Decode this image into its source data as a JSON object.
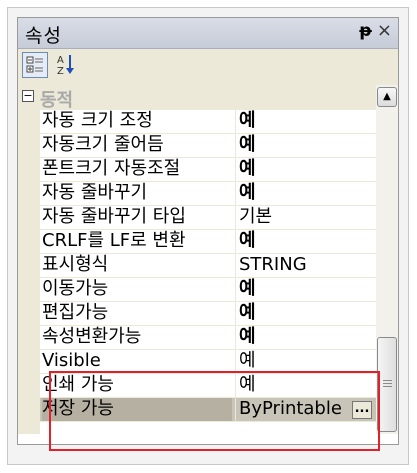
{
  "panel": {
    "title": "속성",
    "pin_glyph": "ᵽ",
    "close_glyph": "×"
  },
  "toolbar": {
    "categorized_icon": "categorized-view-icon",
    "alphabetical_icon": "alphabetical-sort-icon",
    "alphabetical_label": "A↓Z"
  },
  "category": {
    "toggle": "−",
    "label": "동적"
  },
  "properties": [
    {
      "name": "자동 크기 조정",
      "value": "예"
    },
    {
      "name": "자동크기 줄어듬",
      "value": "예"
    },
    {
      "name": "폰트크기 자동조절",
      "value": "예"
    },
    {
      "name": "자동 줄바꾸기",
      "value": "예"
    },
    {
      "name": "자동 줄바꾸기 타입",
      "value": "기본"
    },
    {
      "name": "CRLF를 LF로 변환",
      "value": "예"
    },
    {
      "name": "표시형식",
      "value": "STRING"
    },
    {
      "name": "이동가능",
      "value": "예"
    },
    {
      "name": "편집가능",
      "value": "예"
    },
    {
      "name": "속성변환가능",
      "value": "예"
    },
    {
      "name": "Visible",
      "value": "예"
    },
    {
      "name": "인쇄 가능",
      "value": "예"
    },
    {
      "name": "저장 가능",
      "value": "ByPrintable"
    }
  ],
  "ellipsis_label": "...",
  "scrollbar": {
    "up_arrow": "▲"
  },
  "colors": {
    "highlight": "#e0202a",
    "selected_row": "#c8c4b8",
    "panel_bg": "#ece9d8"
  }
}
